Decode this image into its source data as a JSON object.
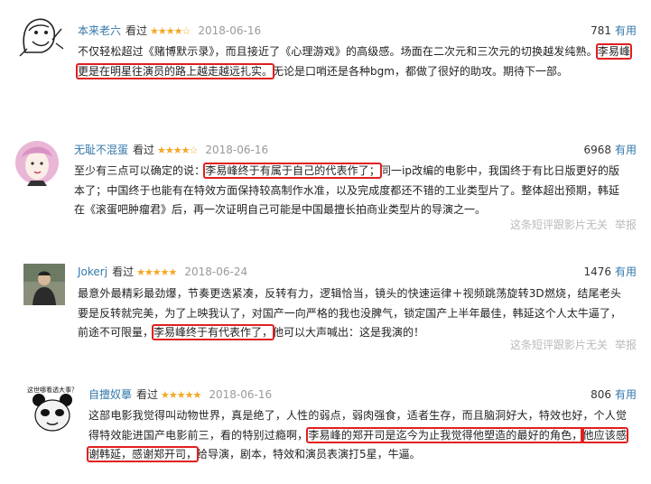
{
  "reviews": [
    {
      "user": "本来老六",
      "watched": "看过",
      "stars": "★★★★☆",
      "date": "2018-06-16",
      "votes": "781",
      "useful_label": "有用",
      "avatar_icon": "meme-face-icon",
      "text_before": "不仅轻松超过《赌博默示录》，而且接近了《心理游戏》的高级感。场面在二次元和三次元的切换越发纯熟。",
      "text_highlight": "李易峰更是在明星往演员的路上越走越远扎实。",
      "text_after": "无论是口哨还是各种bgm，都做了很好的助攻。期待下一部。"
    },
    {
      "user": "无耻不混蛋",
      "watched": "看过",
      "stars": "★★★★☆",
      "date": "2018-06-16",
      "votes": "6968",
      "useful_label": "有用",
      "avatar_icon": "pink-hair-avatar-icon",
      "text_before": "至少有三点可以确定的说：",
      "text_highlight": "李易峰终于有属于自己的代表作了；",
      "text_after": "同一ip改编的电影中，我国终于有比日版更好的版本了；中国终于也能有在特效方面保持较高制作水准，以及完成度都还不错的工业类型片了。整体超出预期，韩延在《滚蛋吧肿瘤君》后，再一次证明自己可能是中国最擅长拍商业类型片的导演之一。",
      "footer_note": "这条短评跟影片无关",
      "report_label": "举报"
    },
    {
      "user": "Jokerj",
      "watched": "看过",
      "stars": "★★★★★",
      "date": "2018-06-24",
      "votes": "1476",
      "useful_label": "有用",
      "avatar_icon": "person-photo-icon",
      "text_before": "最意外最精彩最劲爆，节奏更迭紧凑，反转有力，逻辑恰当，镜头的快速运律＋视频跳荡旋转3D燃烧，结尾老头要是反转就完美，为了上映我认了，对国产一向严格的我也没脾气，锁定国产上半年最佳，韩延这个人太牛逼了，前途不可限量，",
      "text_highlight": "李易峰终于有代表作了，",
      "text_after": "他可以大声喊出：这是我演的！",
      "footer_note": "这条短评跟影片无关",
      "report_label": "举报"
    },
    {
      "user": "自擅奴摹",
      "watched": "看过",
      "stars": "★★★★★",
      "date": "2018-06-16",
      "votes": "806",
      "useful_label": "有用",
      "avatar_icon": "panda-meme-icon",
      "avatar_caption": "这世哪看透大事？",
      "text_before": "这部电影我觉得叫动物世界，真是绝了，人性的弱点，弱肉强食，适者生存，而且脑洞好大，特效也好，个人觉得特效能进国产电影前三，看的特别过瘾啊，",
      "text_highlight": "李易峰的郑开司是迄今为止我觉得他塑造的最好的角色，",
      "text_highlight2": "他应该感谢韩延，感谢郑开司，",
      "text_after": "给导演，剧本，特效和演员表演打5星，牛逼。"
    }
  ]
}
